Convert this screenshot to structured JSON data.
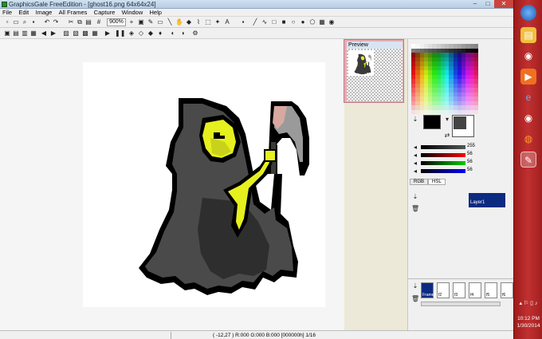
{
  "window": {
    "title": "GraphicsGale FreeEdition - [ghost16.png 64x64x24]",
    "buttons": {
      "minimize": "–",
      "restore": "□",
      "close": "✕"
    }
  },
  "menu": [
    "File",
    "Edit",
    "Image",
    "All Frames",
    "Capture",
    "Window",
    "Help"
  ],
  "toolbar": {
    "zoom": "900%"
  },
  "preview": {
    "title": "Preview"
  },
  "color": {
    "slider_values": [
      "255",
      "56",
      "56",
      "56"
    ],
    "tabs": [
      "RGB",
      "HSL"
    ]
  },
  "layers": {
    "layer_name": "Layer1"
  },
  "frames": [
    {
      "label": "Frame1"
    },
    {
      "label": "f2"
    },
    {
      "label": "f3"
    },
    {
      "label": "f4"
    },
    {
      "label": "f5"
    },
    {
      "label": "f6"
    }
  ],
  "status": {
    "text": "( -12,27 ) R:000 G:000 B:000  [000000h]  1/16"
  },
  "taskbar": {
    "time": "10:12 PM",
    "date": "1/30/2014"
  },
  "colors": {
    "ghost_dark": "#3a3a3a",
    "ghost_mid": "#505050",
    "ghost_outline": "#000000",
    "face_yellow": "#e6f01e",
    "face_yellow_dark": "#c9d21a",
    "scythe_grey": "#9a9a9a",
    "scythe_pink": "#d8a9a0"
  }
}
